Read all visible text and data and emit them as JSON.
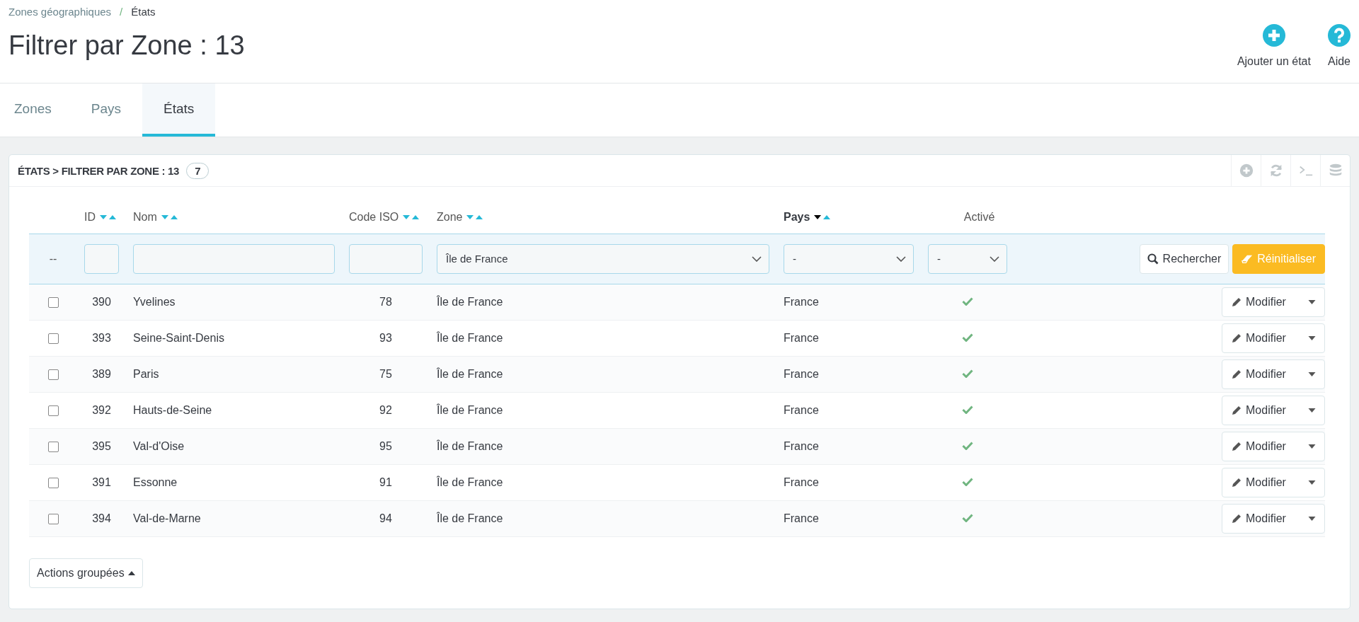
{
  "breadcrumb": {
    "items": [
      "Zones géographiques",
      "États"
    ],
    "separator": "/"
  },
  "title": "Filtrer par Zone : 13",
  "header_actions": [
    {
      "kind": "add",
      "label": "Ajouter un état"
    },
    {
      "kind": "help",
      "label": "Aide"
    }
  ],
  "tabs": [
    {
      "label": "Zones",
      "selected": false
    },
    {
      "label": "Pays",
      "selected": false
    },
    {
      "label": "États",
      "selected": true
    }
  ],
  "panel": {
    "title": "ÉTATS > FILTRER PAR ZONE : 13",
    "count": "7",
    "tools": [
      {
        "kind": "add"
      },
      {
        "kind": "refresh"
      },
      {
        "kind": "sql"
      },
      {
        "kind": "database"
      }
    ]
  },
  "table": {
    "columns": [
      {
        "label": "ID",
        "sortable": true,
        "sort_desc": false,
        "sort_asc": false
      },
      {
        "label": "Nom",
        "sortable": true,
        "sort_desc": false,
        "sort_asc": false
      },
      {
        "label": "Code ISO",
        "sortable": true,
        "sort_desc": false,
        "sort_asc": false
      },
      {
        "label": "Zone",
        "sortable": true,
        "sort_desc": false,
        "sort_asc": false
      },
      {
        "label": "Pays",
        "sortable": true,
        "sort_desc": true,
        "sort_asc": false
      },
      {
        "label": "Activé",
        "sortable": false
      }
    ],
    "filters": [
      {
        "kind": "empty",
        "text": "--"
      },
      {
        "kind": "text"
      },
      {
        "kind": "text"
      },
      {
        "kind": "text"
      },
      {
        "kind": "select",
        "value": "Île de France"
      },
      {
        "kind": "select",
        "value": "-"
      },
      {
        "kind": "select",
        "value": "-"
      }
    ],
    "search_button": "Rechercher",
    "reset_button": "Réinitialiser",
    "rows": [
      {
        "checked": false,
        "id": "390",
        "name": "Yvelines",
        "iso": "78",
        "zone": "Île de France",
        "country": "France",
        "active": true,
        "action": "Modifier"
      },
      {
        "checked": false,
        "id": "393",
        "name": "Seine-Saint-Denis",
        "iso": "93",
        "zone": "Île de France",
        "country": "France",
        "active": true,
        "action": "Modifier"
      },
      {
        "checked": false,
        "id": "389",
        "name": "Paris",
        "iso": "75",
        "zone": "Île de France",
        "country": "France",
        "active": true,
        "action": "Modifier"
      },
      {
        "checked": false,
        "id": "392",
        "name": "Hauts-de-Seine",
        "iso": "92",
        "zone": "Île de France",
        "country": "France",
        "active": true,
        "action": "Modifier"
      },
      {
        "checked": false,
        "id": "395",
        "name": "Val-d'Oise",
        "iso": "95",
        "zone": "Île de France",
        "country": "France",
        "active": true,
        "action": "Modifier"
      },
      {
        "checked": false,
        "id": "391",
        "name": "Essonne",
        "iso": "91",
        "zone": "Île de France",
        "country": "France",
        "active": true,
        "action": "Modifier"
      },
      {
        "checked": false,
        "id": "394",
        "name": "Val-de-Marne",
        "iso": "94",
        "zone": "Île de France",
        "country": "France",
        "active": true,
        "action": "Modifier"
      }
    ],
    "bulk_actions": "Actions groupées"
  }
}
